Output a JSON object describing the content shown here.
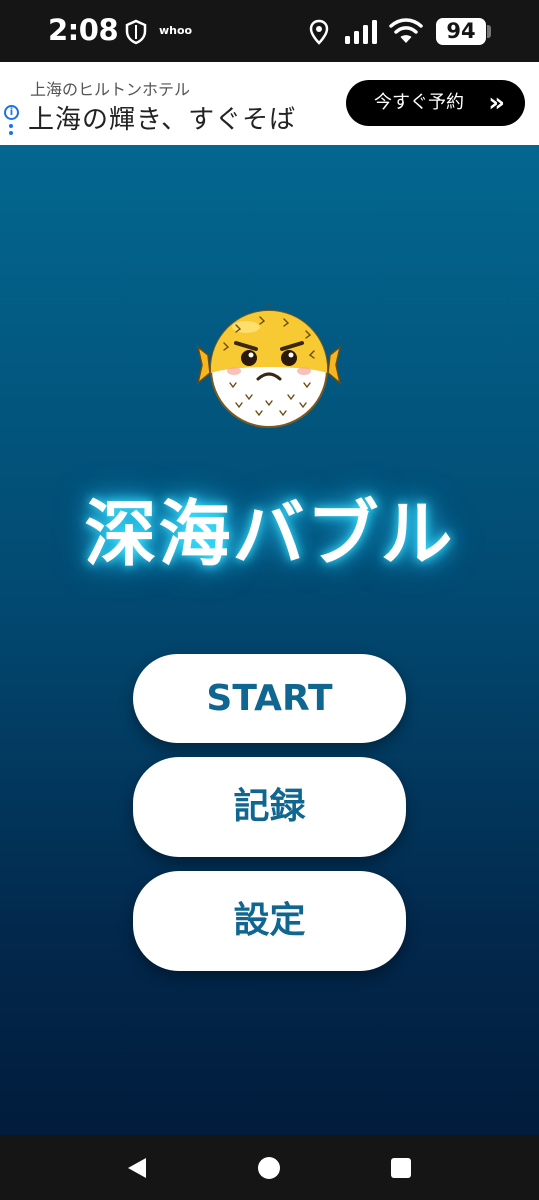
{
  "status_bar": {
    "time": "2:08",
    "app_label": "whoo",
    "battery": "94"
  },
  "ad": {
    "subtitle": "上海のヒルトンホテル",
    "title": "上海の輝き、すぐそば",
    "cta_label": "今すぐ予約",
    "cta_icon": "double-chevron-right",
    "info_icon": "i"
  },
  "game": {
    "title": "深海バブル",
    "mascot_icon": "pufferfish",
    "title_glow_color": "#3fe8ff",
    "menu": {
      "start_label": "START",
      "records_label": "記録",
      "settings_label": "設定"
    },
    "accent_color": "#0f6690",
    "background_top": "#03678f",
    "background_bottom": "#011c3c"
  },
  "nav": {
    "back_icon": "back-triangle",
    "home_icon": "home-circle",
    "recents_icon": "recents-square"
  }
}
